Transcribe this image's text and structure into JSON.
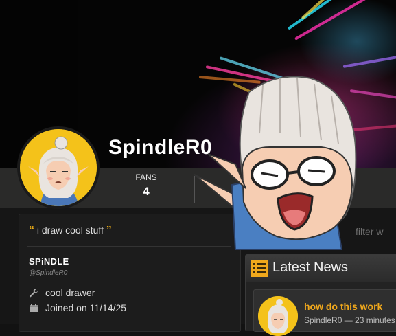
{
  "profile": {
    "username": "SpindleR0",
    "fans_label": "FANS",
    "fans_count": "4"
  },
  "about": {
    "quote_open": "“",
    "bio": "i draw cool stuff",
    "quote_close": "”",
    "display_name": "SPiNDLE",
    "handle": "@SpindleR0",
    "occupation": "cool drawer",
    "joined": "Joined on 11/14/25"
  },
  "filter": {
    "placeholder": "filter w"
  },
  "news": {
    "title": "Latest News",
    "items": [
      {
        "title": "how do this work",
        "meta": "SpindleR0 — 23 minutes"
      }
    ]
  },
  "colors": {
    "accent": "#f0a81c",
    "avatar_bg": "#f4c21a"
  },
  "icons": [
    "wrench-icon",
    "calendar-icon",
    "news-icon"
  ]
}
